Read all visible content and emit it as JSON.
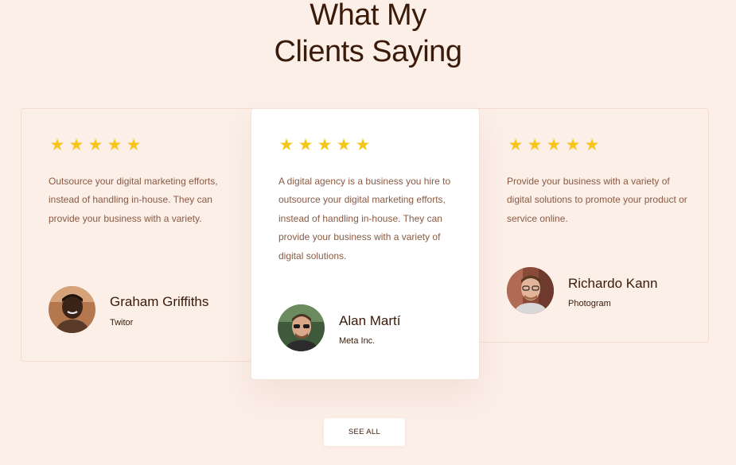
{
  "section": {
    "title_line1": "What My",
    "title_line2": "Clients Saying"
  },
  "testimonials": [
    {
      "rating": 5,
      "stars": "★ ★ ★ ★ ★",
      "quote": "Outsource your digital marketing efforts, instead of handling in-house. They can provide your business with a variety.",
      "name": "Graham Griffiths",
      "company": "Twitor",
      "avatar_icon": "person-photo-icon"
    },
    {
      "rating": 5,
      "stars": "★ ★ ★ ★ ★",
      "quote": "A digital agency is a business you hire to outsource your digital marketing efforts, instead of handling in-house. They can provide your business with a variety of digital solutions.",
      "name": "Alan Martí",
      "company": "Meta Inc.",
      "avatar_icon": "person-photo-icon"
    },
    {
      "rating": 5,
      "stars": "★ ★ ★ ★ ★",
      "quote": "Provide your business with a variety of digital solutions to promote your product or service online.",
      "name": "Richardo Kann",
      "company": "Photogram",
      "avatar_icon": "person-photo-icon"
    }
  ],
  "see_all_button": {
    "label": "SEE ALL"
  },
  "colors": {
    "background": "#fcefe8",
    "heading": "#3a1a08",
    "body_text": "#8a5a43",
    "star": "#f5c518",
    "card_highlight": "#ffffff"
  }
}
